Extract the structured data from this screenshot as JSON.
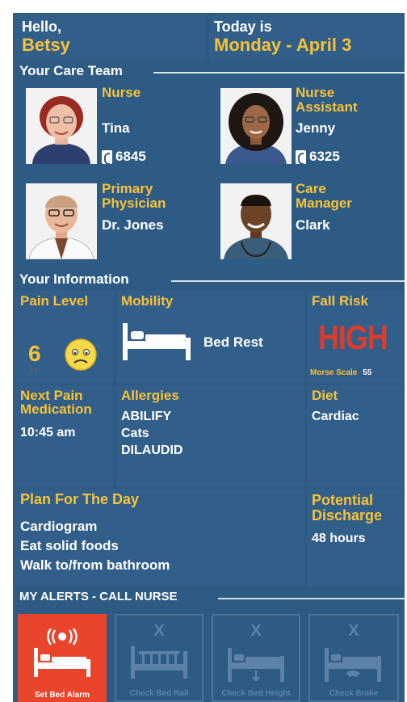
{
  "header": {
    "greeting": "Hello,",
    "patient_name": "Betsy",
    "today_label": "Today is",
    "date": "Monday - April 3"
  },
  "care_team": {
    "title": "Your Care Team",
    "members": [
      {
        "role_line1": "Nurse",
        "role_line2": "",
        "name": "Tina",
        "ext": "6845"
      },
      {
        "role_line1": "Nurse",
        "role_line2": "Assistant",
        "name": "Jenny",
        "ext": "6325"
      },
      {
        "role_line1": "Primary",
        "role_line2": "Physician",
        "name": "Dr. Jones",
        "ext": ""
      },
      {
        "role_line1": "Care",
        "role_line2": "Manager",
        "name": "Clark",
        "ext": ""
      }
    ]
  },
  "info": {
    "title": "Your Information",
    "pain": {
      "label": "Pain Level",
      "value": "6",
      "trend": "↑↑"
    },
    "mobility": {
      "label": "Mobility",
      "value": "Bed Rest"
    },
    "fall_risk": {
      "label": "Fall Risk",
      "value": "HIGH",
      "scale_label": "Morse Scale",
      "scale_value": "55"
    },
    "next_med": {
      "label_line1": "Next Pain",
      "label_line2": "Medication",
      "value": "10:45 am"
    },
    "allergies": {
      "label": "Allergies",
      "items": [
        "ABILIFY",
        "Cats",
        "DILAUDID"
      ]
    },
    "diet": {
      "label": "Diet",
      "value": "Cardiac"
    },
    "plan": {
      "label": "Plan For The Day",
      "items": [
        "Cardiogram",
        "Eat solid foods",
        "Walk to/from bathroom"
      ]
    },
    "discharge": {
      "label_line1": "Potential",
      "label_line2": "Discharge",
      "value": "48 hours"
    }
  },
  "alerts": {
    "title": "MY ALERTS - CALL NURSE",
    "items": [
      {
        "label": "Set Bed Alarm",
        "active": true
      },
      {
        "label": "Check Bed Rail",
        "active": false
      },
      {
        "label": "Check Bed Height",
        "active": false
      },
      {
        "label": "Check Brake",
        "active": false
      }
    ],
    "disabled_mark": "X"
  },
  "colors": {
    "background": "#2d5b84",
    "tile": "#325f89",
    "accent_yellow": "#f6c23a",
    "alert_red": "#e8452c",
    "high_red": "#e03a2a"
  }
}
